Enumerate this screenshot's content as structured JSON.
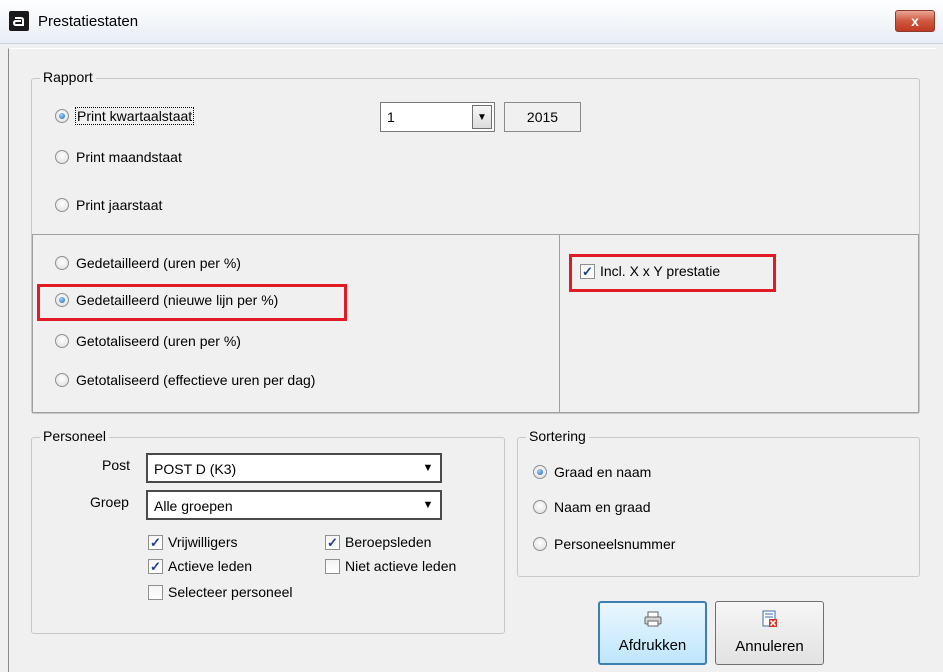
{
  "window": {
    "title": "Prestatiestaten",
    "close_label": "x"
  },
  "rapport": {
    "legend": "Rapport",
    "options": [
      {
        "label": "Print kwartaalstaat",
        "selected": true
      },
      {
        "label": "Print maandstaat",
        "selected": false
      },
      {
        "label": "Print jaarstaat",
        "selected": false
      }
    ],
    "quarter_value": "1",
    "year_value": "2015"
  },
  "detail": {
    "options": [
      {
        "label": "Gedetailleerd (uren per %)",
        "selected": false
      },
      {
        "label": "Gedetailleerd (nieuwe lijn per %)",
        "selected": true
      },
      {
        "label": "Getotaliseerd (uren per %)",
        "selected": false
      },
      {
        "label": "Getotaliseerd (effectieve uren per dag)",
        "selected": false
      }
    ],
    "incl_label": "Incl. X x Y prestatie",
    "incl_checked": true
  },
  "personeel": {
    "legend": "Personeel",
    "post_label": "Post",
    "post_value": "POST D (K3)",
    "groep_label": "Groep",
    "groep_value": "Alle groepen",
    "checks": {
      "vrijwilligers": {
        "label": "Vrijwilligers",
        "checked": true
      },
      "beroepsleden": {
        "label": "Beroepsleden",
        "checked": true
      },
      "actieve": {
        "label": "Actieve leden",
        "checked": true
      },
      "niet_actieve": {
        "label": "Niet actieve leden",
        "checked": false
      },
      "selecteer": {
        "label": "Selecteer personeel",
        "checked": false
      }
    }
  },
  "sortering": {
    "legend": "Sortering",
    "options": [
      {
        "label": "Graad en naam",
        "selected": true
      },
      {
        "label": "Naam en graad",
        "selected": false
      },
      {
        "label": "Personeelsnummer",
        "selected": false
      }
    ]
  },
  "buttons": {
    "print_label": "Afdrukken",
    "cancel_label": "Annuleren",
    "print_icon": "printer-icon",
    "cancel_icon": "cancel-document-icon"
  },
  "colors": {
    "highlight": "#e01b24",
    "default_button": "#3c7fb1"
  }
}
